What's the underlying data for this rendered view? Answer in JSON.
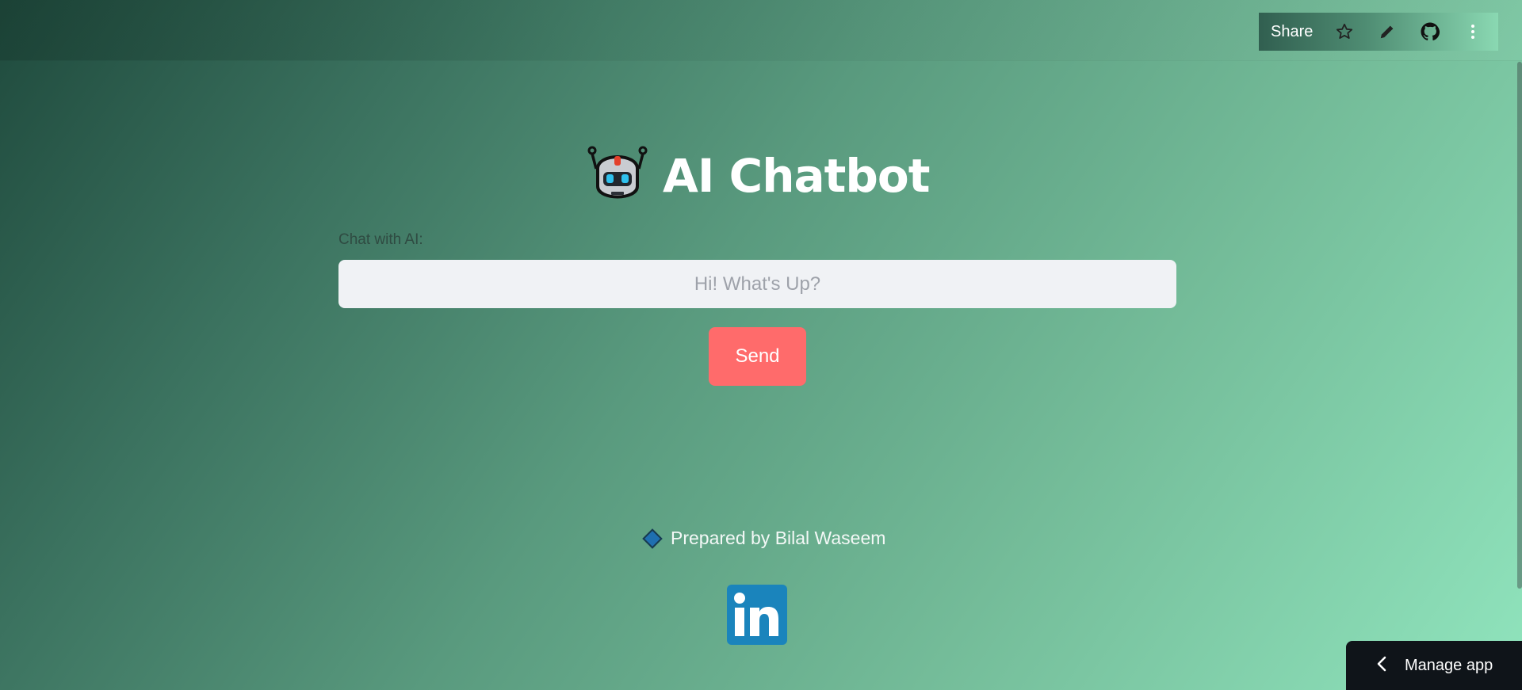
{
  "header": {
    "share_label": "Share",
    "icons": [
      "star-icon",
      "pencil-icon",
      "github-icon",
      "more-vertical-icon"
    ]
  },
  "main": {
    "title": "AI Chatbot",
    "title_icon": "robot-icon",
    "input_label": "Chat with AI:",
    "input_placeholder": "Hi! What's Up?",
    "input_value": "",
    "send_label": "Send"
  },
  "footer": {
    "credit": "Prepared by Bilal Waseem",
    "credit_icon": "blue-diamond-icon",
    "linkedin_icon": "linkedin-icon"
  },
  "manage_app": {
    "label": "Manage app"
  },
  "colors": {
    "send_button": "#ff6b6b",
    "input_bg": "#f0f2f5",
    "manage_bg": "#0f1419",
    "linkedin": "#1a84bc"
  }
}
